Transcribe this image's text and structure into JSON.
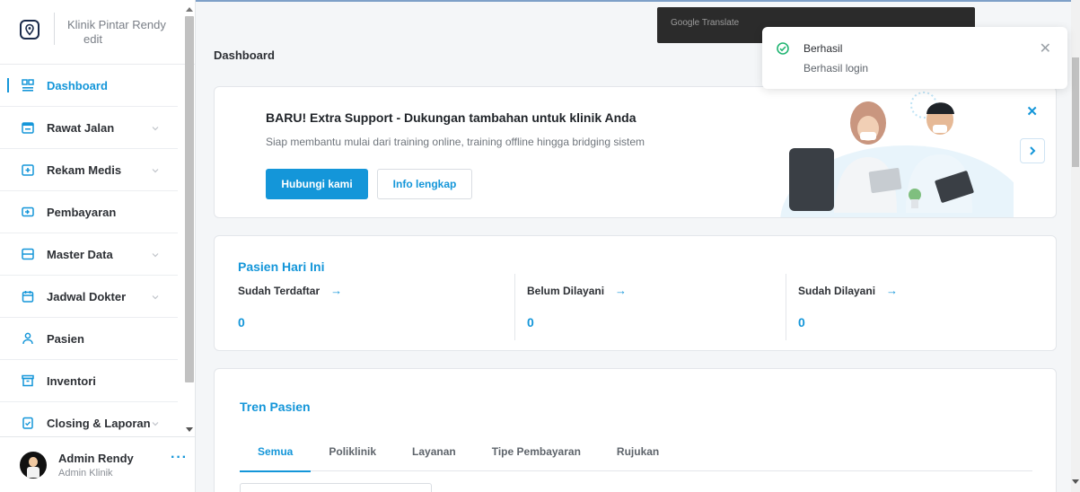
{
  "sidebar": {
    "brand": {
      "name": "Klinik Pintar Rendy",
      "edit_label": "edit"
    },
    "items": [
      {
        "label": "Dashboard",
        "icon": "dashboard-icon",
        "active": true,
        "expandable": false
      },
      {
        "label": "Rawat Jalan",
        "icon": "outpatient-icon",
        "active": false,
        "expandable": true
      },
      {
        "label": "Rekam Medis",
        "icon": "medical-record-icon",
        "active": false,
        "expandable": true
      },
      {
        "label": "Pembayaran",
        "icon": "payment-icon",
        "active": false,
        "expandable": false
      },
      {
        "label": "Master Data",
        "icon": "master-data-icon",
        "active": false,
        "expandable": true
      },
      {
        "label": "Jadwal Dokter",
        "icon": "calendar-icon",
        "active": false,
        "expandable": true
      },
      {
        "label": "Pasien",
        "icon": "patient-icon",
        "active": false,
        "expandable": false
      },
      {
        "label": "Inventori",
        "icon": "inventory-icon",
        "active": false,
        "expandable": false
      },
      {
        "label": "Closing & Laporan",
        "icon": "report-icon",
        "active": false,
        "expandable": true
      }
    ],
    "user": {
      "name": "Admin Rendy",
      "role": "Admin Klinik",
      "more": "···"
    }
  },
  "main": {
    "page_title": "Dashboard",
    "promo": {
      "title": "BARU! Extra Support - Dukungan tambahan untuk klinik Anda",
      "subtitle": "Siap membantu mulai dari training online, training offline hingga bridging sistem",
      "primary_button": "Hubungi kami",
      "secondary_button": "Info lengkap",
      "close": "✕"
    },
    "stats": {
      "title": "Pasien Hari Ini",
      "items": [
        {
          "label": "Sudah Terdaftar",
          "value": "0"
        },
        {
          "label": "Belum Dilayani",
          "value": "0"
        },
        {
          "label": "Sudah Dilayani",
          "value": "0"
        }
      ],
      "arrow": "→"
    },
    "trend": {
      "title": "Tren Pasien",
      "tabs": [
        "Semua",
        "Poliklinik",
        "Layanan",
        "Tipe Pembayaran",
        "Rujukan"
      ],
      "active_tab": "Semua"
    }
  },
  "overlays": {
    "google_translate": "Google Translate",
    "toast": {
      "title": "Berhasil",
      "message": "Berhasil login",
      "close": "✕"
    }
  },
  "colors": {
    "accent": "#1496d9",
    "success": "#22b573",
    "text": "#2d3035"
  }
}
